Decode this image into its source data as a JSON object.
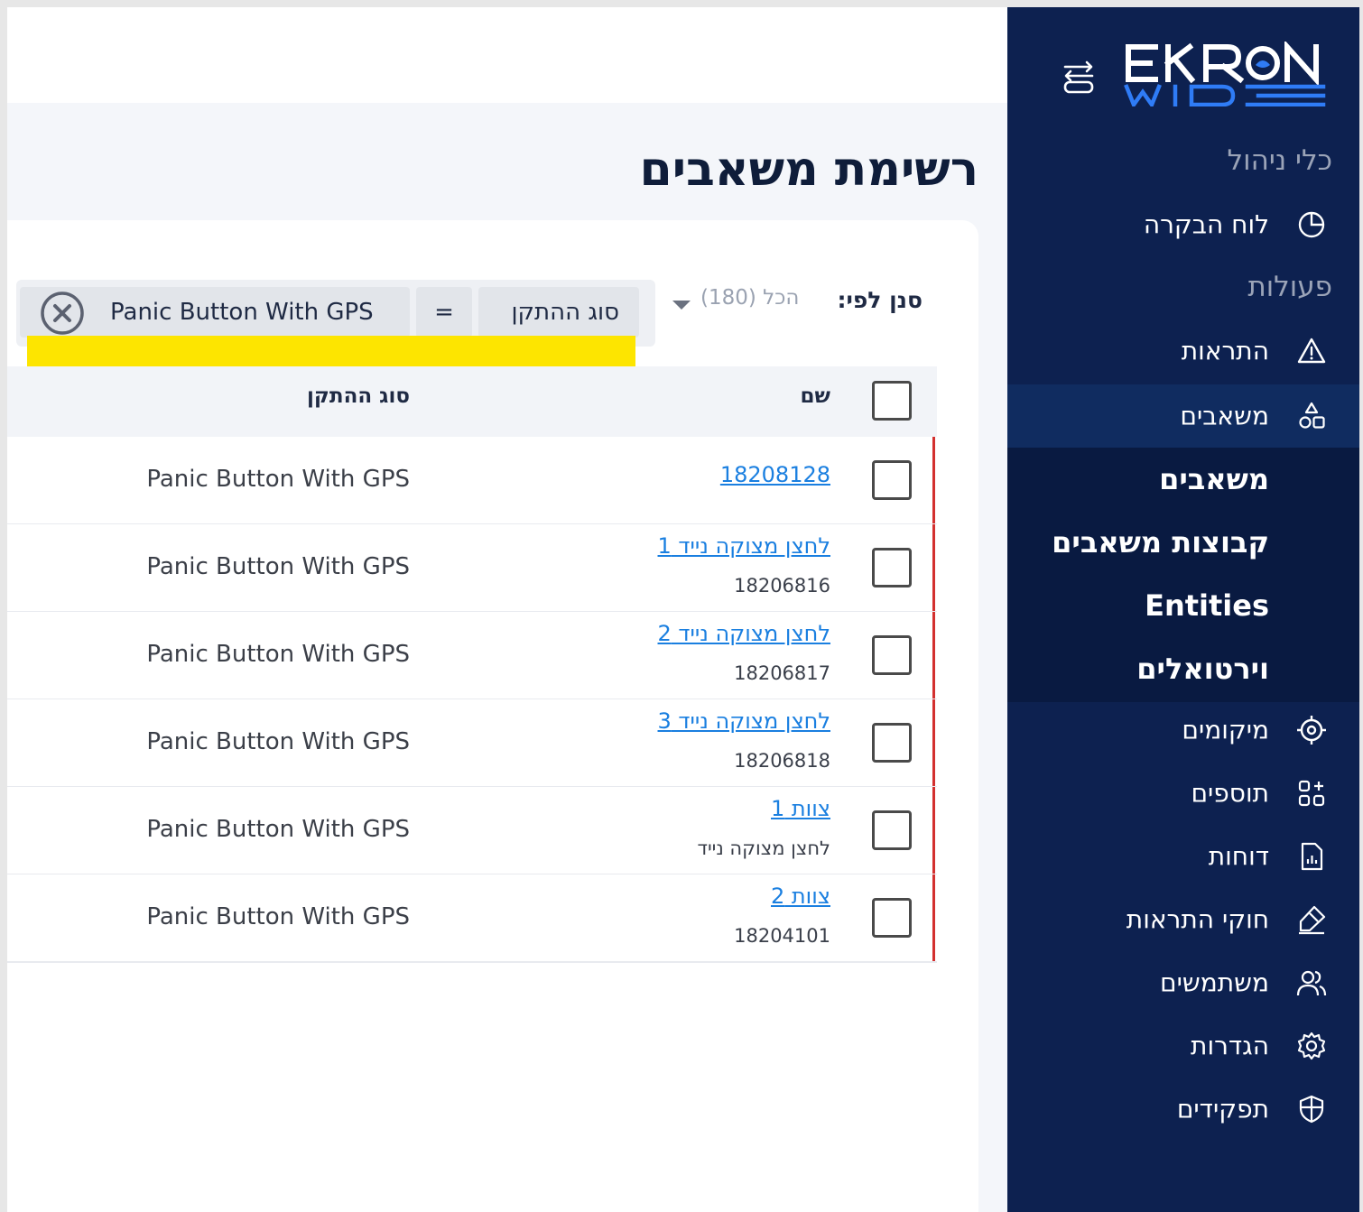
{
  "app": {
    "name": "EKRON WIDE"
  },
  "sidebar": {
    "sections": [
      {
        "title": "כלי ניהול"
      },
      {
        "title": "פעולות"
      }
    ],
    "nav": [
      {
        "label": "לוח הבקרה",
        "icon": "pie-chart-icon"
      },
      {
        "label": "התראות",
        "icon": "warning-icon"
      },
      {
        "label": "משאבים",
        "icon": "shapes-icon"
      },
      {
        "label": "מיקומים",
        "icon": "target-icon"
      },
      {
        "label": "תוספים",
        "icon": "add-grid-icon"
      },
      {
        "label": "דוחות",
        "icon": "report-file-icon"
      },
      {
        "label": "חוקי התראות",
        "icon": "rule-pen-icon"
      },
      {
        "label": "משתמשים",
        "icon": "users-icon"
      },
      {
        "label": "הגדרות",
        "icon": "gear-icon"
      },
      {
        "label": "תפקידים",
        "icon": "shield-icon"
      }
    ],
    "sub_nav": [
      {
        "label": "משאבים"
      },
      {
        "label": "קבוצות משאבים"
      },
      {
        "label": "Entities"
      },
      {
        "label": "וירטואלים"
      }
    ],
    "active_item": "משאבים"
  },
  "page": {
    "title": "רשימת משאבים"
  },
  "filter": {
    "label": "סנן לפי:",
    "dropdown_value": "הכל (180)",
    "chip": {
      "field": "סוג ההתקן",
      "operator": "=",
      "value": "Panic Button With GPS"
    }
  },
  "table": {
    "columns": {
      "name": "שם",
      "type": "סוג ההתקן"
    },
    "rows": [
      {
        "name": "18208128",
        "sub": "",
        "type": "Panic Button With GPS"
      },
      {
        "name": "לחצן מצוקה נייד 1",
        "sub": "18206816",
        "type": "Panic Button With GPS"
      },
      {
        "name": "לחצן מצוקה נייד 2",
        "sub": "18206817",
        "type": "Panic Button With GPS"
      },
      {
        "name": "לחצן מצוקה נייד 3",
        "sub": "18206818",
        "type": "Panic Button With GPS"
      },
      {
        "name": "צוות 1",
        "sub": "לחצן מצוקה נייד",
        "type": "Panic Button With GPS"
      },
      {
        "name": "צוות 2",
        "sub": "18204101",
        "type": "Panic Button With GPS"
      }
    ]
  },
  "colors": {
    "sidebar_bg": "#0d2150",
    "logo_blue": "#2f7cf6",
    "link": "#1a7fe0",
    "row_marker": "#d3302f",
    "highlight": "#fde500"
  }
}
